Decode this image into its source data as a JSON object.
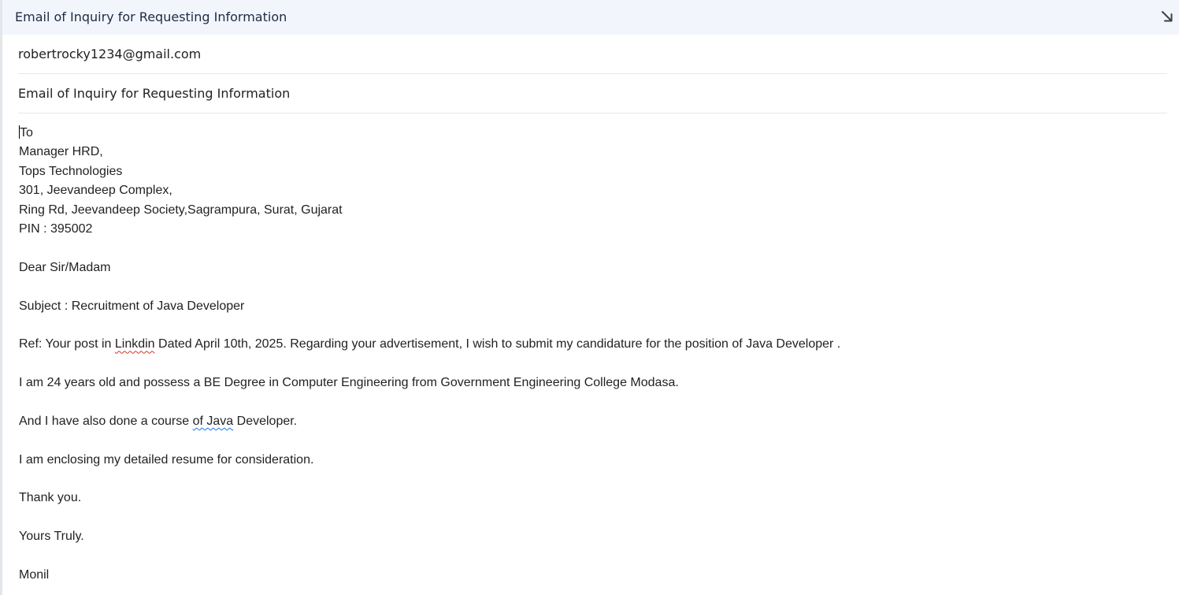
{
  "window": {
    "title": "Email of Inquiry for Requesting Information",
    "expand_icon": "diagonal-arrow-icon"
  },
  "compose": {
    "to": "robertrocky1234@gmail.com",
    "subject": "Email of Inquiry for Requesting Information"
  },
  "body": {
    "address": {
      "to": "To",
      "line1": "Manager HRD,",
      "line2": "Tops Technologies",
      "line3": "301, Jeevandeep Complex,",
      "line4": "Ring Rd, Jeevandeep Society,Sagrampura, Surat, Gujarat",
      "line5": "PIN : 395002"
    },
    "salutation": "Dear Sir/Madam",
    "subject_line": "Subject : Recruitment of Java Developer",
    "ref": {
      "part1": "Ref: Your post in ",
      "misspelled": "Linkdin",
      "part2": " Dated April 10th, 2025. Regarding your advertisement, I wish to submit my candidature for the position of Java Developer ."
    },
    "education": "I am 24 years old and possess a BE Degree in Computer Engineering from Government Engineering College Modasa.",
    "course": {
      "part1": "And I have also done a course ",
      "grammar": "of Java",
      "part2": " Developer."
    },
    "resume": "I am enclosing my detailed resume for consideration.",
    "thanks": "Thank you.",
    "closing": "Yours Truly.",
    "signature": "Monil"
  },
  "colors": {
    "titlebar_bg": "#f2f6fc",
    "spell_error": "#d93025",
    "grammar_error": "#1a73e8"
  }
}
